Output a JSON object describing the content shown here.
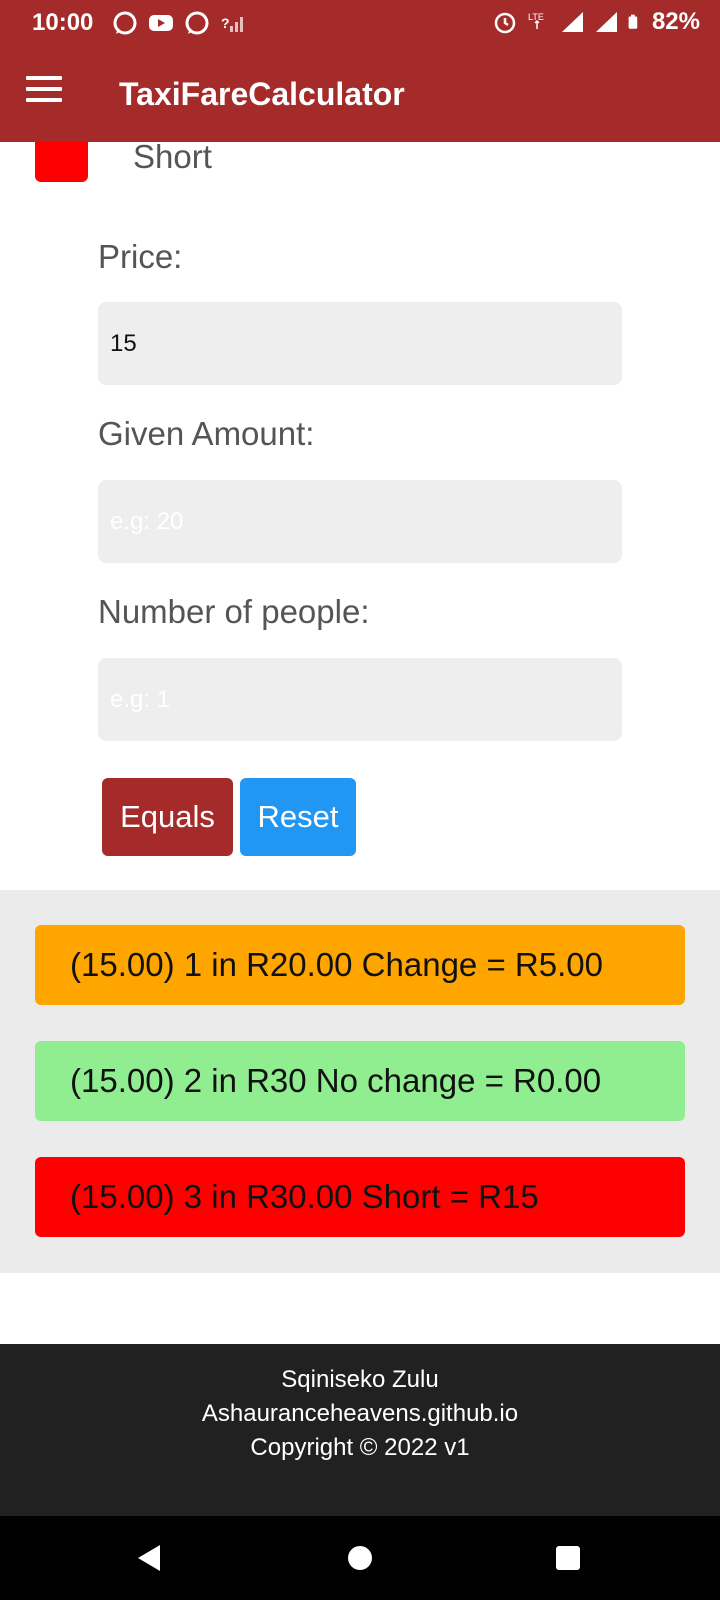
{
  "status_bar": {
    "time": "10:00",
    "battery": "82%",
    "left_icons": [
      "whatsapp-icon",
      "youtube-icon",
      "whatsapp-icon",
      "no-signal-icon"
    ],
    "right_icons": [
      "alarm-icon",
      "lte-icon",
      "signal-icon",
      "signal-icon",
      "battery-icon"
    ]
  },
  "app_bar": {
    "title": "TaxiFareCalculator",
    "menu_icon": "hamburger-menu-icon"
  },
  "legend": {
    "label": "Short",
    "color": "#ff0000"
  },
  "form": {
    "price_label": "Price:",
    "price_value": "15",
    "given_label": "Given Amount:",
    "given_placeholder": "e.g: 20",
    "people_label": "Number of people:",
    "people_placeholder": "e.g: 1",
    "equals_label": "Equals",
    "reset_label": "Reset"
  },
  "results": [
    {
      "text": "(15.00) 1 in R20.00 Change = R5.00",
      "color": "#ffa500"
    },
    {
      "text": "(15.00) 2 in R30 No change = R0.00",
      "color": "#90ee90"
    },
    {
      "text": "(15.00) 3 in R30.00 Short = R15",
      "color": "#ff0000"
    }
  ],
  "footer": {
    "author": "Sqiniseko Zulu",
    "site": "Ashauranceheavens.github.io",
    "copyright": "Copyright © 2022 v1"
  },
  "colors": {
    "primary": "#a52a2a",
    "reset_button": "#2196f3",
    "footer_bg": "#212121"
  }
}
